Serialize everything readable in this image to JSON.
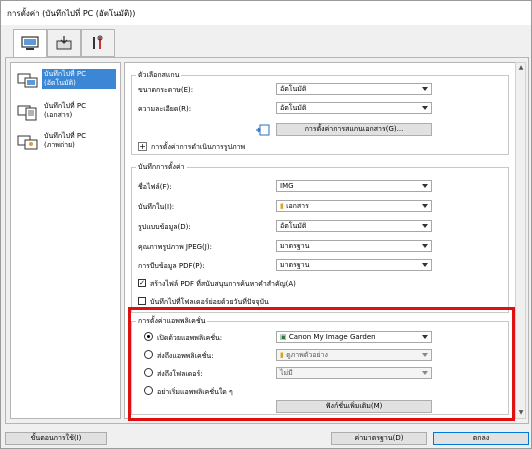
{
  "window": {
    "title": "การตั้งค่า (บันทึกไปที่ PC (อัตโนมัติ))"
  },
  "tabs": [
    {
      "icon": "computer-scan-icon"
    },
    {
      "icon": "device-scan-icon"
    },
    {
      "icon": "tools-icon"
    }
  ],
  "sidebar": {
    "items": [
      {
        "label": "บันทึกไปที่ PC (อัตโนมัติ)",
        "selected": true,
        "icon": "scan-auto-icon"
      },
      {
        "label": "บันทึกไปที่ PC (เอกสาร)",
        "selected": false,
        "icon": "scan-document-icon"
      },
      {
        "label": "บันทึกไปที่ PC (ภาพถ่าย)",
        "selected": false,
        "icon": "scan-photo-icon"
      }
    ]
  },
  "scan_options": {
    "legend": "ตัวเลือกสแกน",
    "paper_size_label": "ขนาดกระดาษ(E):",
    "paper_size_value": "อัตโนมัติ",
    "resolution_label": "ความละเอียด(R):",
    "resolution_value": "อัตโนมัติ",
    "doc_scan_button": "การตั้งค่าการสแกนเอกสาร(G)...",
    "image_processing": "การตั้งค่าการดำเนินการรูปภาพ"
  },
  "save_settings": {
    "legend": "บันทึกการตั้งค่า",
    "file_name_label": "ชื่อไฟล์(F):",
    "file_name_value": "IMG",
    "save_in_label": "บันทึกใน(I):",
    "save_in_value": "เอกสาร",
    "data_format_label": "รูปแบบข้อมูล(D):",
    "data_format_value": "อัตโนมัติ",
    "jpeg_quality_label": "คุณภาพรูปภาพ JPEG(J):",
    "jpeg_quality_value": "มาตรฐาน",
    "pdf_compression_label": "การบีบข้อมูล PDF(P):",
    "pdf_compression_value": "มาตรฐาน",
    "searchable_pdf_label": "สร้างไฟล์ PDF ที่สนับสนุนการค้นหาคำสำคัญ(A)",
    "searchable_pdf_checked": true,
    "subfolder_label": "บันทึกไปที่โฟลเดอร์ย่อยด้วยวันที่ปัจจุบัน",
    "subfolder_checked": false
  },
  "app_settings": {
    "legend": "การตั้งค่าแอพพลิเคชั่น",
    "open_with_label": "เปิดด้วยแอพพลิเคชั่น:",
    "open_with_value": "Canon My Image Garden",
    "send_to_app_label": "ส่งถึงแอพพลิเคชั่น:",
    "send_to_app_value": "ดูภาพตัวอย่าง",
    "send_to_folder_label": "ส่งถึงโฟลเดอร์:",
    "send_to_folder_value": "ไม่มี",
    "no_app_label": "อย่าเริ่มแอพพลิเคชั่นใด ๆ",
    "more_functions_button": "ฟังก์ชั่นเพิ่มเติม(M)"
  },
  "footer": {
    "instructions_button": "ขั้นตอนการใช้(I)",
    "defaults_button": "ค่ามาตรฐาน(D)",
    "ok_button": "ตกลง"
  },
  "colors": {
    "selection": "#3b87d6",
    "highlight": "#e01010"
  }
}
